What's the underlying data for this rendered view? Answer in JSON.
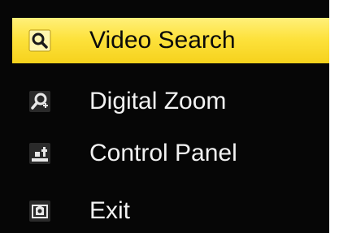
{
  "menu": {
    "items": [
      {
        "label": "Video Search",
        "icon": "search-icon",
        "selected": true
      },
      {
        "label": "Digital Zoom",
        "icon": "zoom-icon",
        "selected": false
      },
      {
        "label": "Control Panel",
        "icon": "control-panel-icon",
        "selected": false
      },
      {
        "label": "Exit",
        "icon": "exit-icon",
        "selected": false
      }
    ]
  },
  "colors": {
    "menu_background": "#060606",
    "highlight": "#fde23d",
    "text": "#f2f2f2",
    "selected_text": "#0a0a0a"
  }
}
